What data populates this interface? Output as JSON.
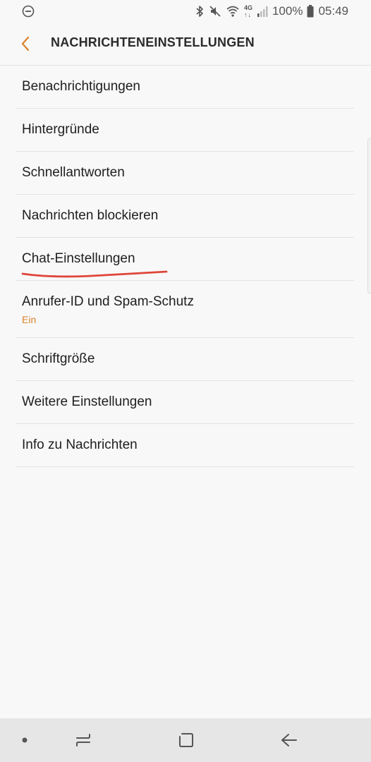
{
  "status_bar": {
    "battery_percent": "100%",
    "time": "05:49",
    "icons": [
      "do-not-disturb-icon",
      "bluetooth-icon",
      "mute-icon",
      "wifi-icon",
      "4g-icon",
      "signal-icon",
      "battery-icon"
    ],
    "network_label": "4G"
  },
  "header": {
    "title": "NACHRICHTENEINSTELLUNGEN",
    "back_icon": "chevron-left-icon"
  },
  "settings": {
    "items": [
      {
        "label": "Benachrichtigungen"
      },
      {
        "label": "Hintergründe"
      },
      {
        "label": "Schnellantworten"
      },
      {
        "label": "Nachrichten blockieren"
      },
      {
        "label": "Chat-Einstellungen",
        "annotated": true
      },
      {
        "label": "Anrufer-ID und Spam-Schutz",
        "sub": "Ein"
      },
      {
        "label": "Schriftgröße"
      },
      {
        "label": "Weitere Einstellungen"
      },
      {
        "label": "Info zu Nachrichten"
      }
    ]
  },
  "colors": {
    "accent": "#d9822b",
    "annotation": "#e0453a",
    "background": "#f8f8f8",
    "navbar": "#e6e6e6"
  },
  "nav_bar": {
    "icons": [
      "dot-icon",
      "recent-apps-icon",
      "home-icon",
      "back-arrow-icon"
    ]
  }
}
